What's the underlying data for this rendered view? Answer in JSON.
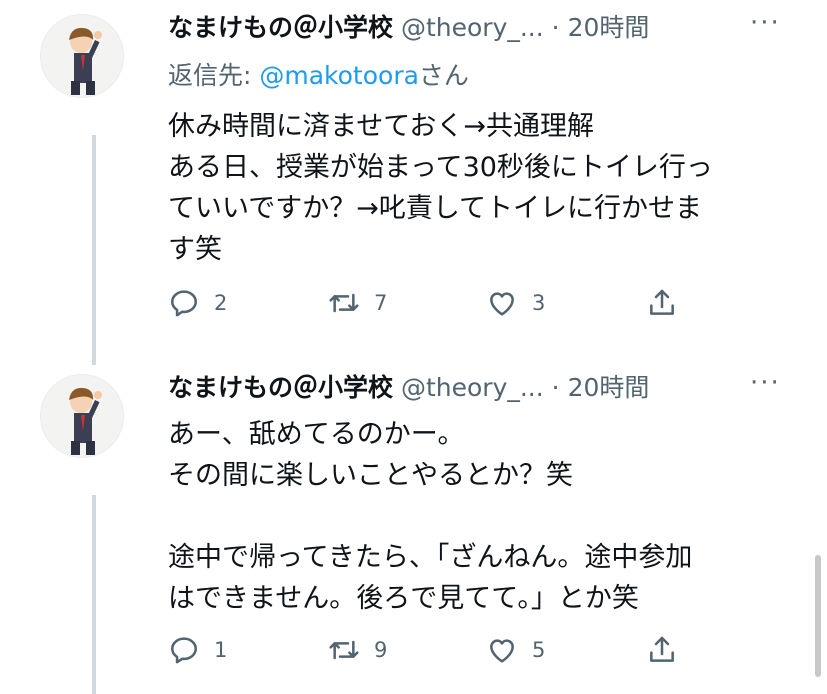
{
  "tweets": [
    {
      "name": "なまけもの＠小学校",
      "handle": "@theory_...",
      "dot": "·",
      "time": "20時間",
      "reply_prefix": "返信先: ",
      "reply_mention": "@makotoora",
      "reply_suffix": "さん",
      "lines": [
        "休み時間に済ませておく→共通理解",
        "ある日、授業が始まって30秒後にトイレ行っ",
        "ていいですか？→叱責してトイレに行かせま",
        "す笑"
      ],
      "reply_count": "2",
      "retweet_count": "7",
      "like_count": "3"
    },
    {
      "name": "なまけもの＠小学校",
      "handle": "@theory_...",
      "dot": "·",
      "time": "20時間",
      "lines": [
        "あー、舐めてるのかー。",
        "その間に楽しいことやるとか？笑",
        "",
        "途中で帰ってきたら、「ざんねん。途中参加",
        "はできません。後ろで見てて。」とか笑"
      ],
      "reply_count": "1",
      "retweet_count": "9",
      "like_count": "5"
    }
  ],
  "colors": {
    "text": "#0f1419",
    "secondary": "#536471",
    "accent": "#1d9bf0",
    "thread": "#cfd9de"
  },
  "icons": [
    "avatar",
    "more-icon",
    "reply-icon",
    "retweet-icon",
    "like-icon",
    "share-icon"
  ]
}
